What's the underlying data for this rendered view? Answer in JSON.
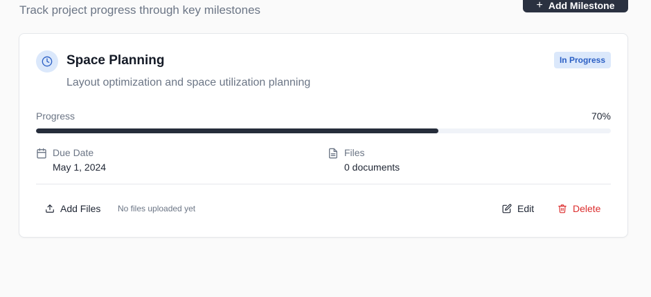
{
  "header": {
    "subtitle": "Track project progress through key milestones",
    "add_button_label": "Add Milestone"
  },
  "milestone": {
    "title": "Space Planning",
    "status": "In Progress",
    "description": "Layout optimization and space utilization planning",
    "progress_label": "Progress",
    "progress_text": "70%",
    "progress_percent": 70,
    "due_label": "Due Date",
    "due_value": "May 1, 2024",
    "files_label": "Files",
    "files_value": "0 documents"
  },
  "footer": {
    "add_files_label": "Add Files",
    "no_files_text": "No files uploaded yet",
    "edit_label": "Edit",
    "delete_label": "Delete"
  },
  "colors": {
    "primary": "#2a3140",
    "status_bg": "#dbe8fb",
    "status_text": "#2b5fc4",
    "danger": "#dc2c2c",
    "muted": "#6b7585"
  },
  "icons": {
    "status": "clock-icon",
    "due": "calendar-icon",
    "files": "file-text-icon",
    "add_files": "upload-icon",
    "edit": "edit-icon",
    "delete": "trash-icon",
    "add_milestone": "plus-icon"
  }
}
